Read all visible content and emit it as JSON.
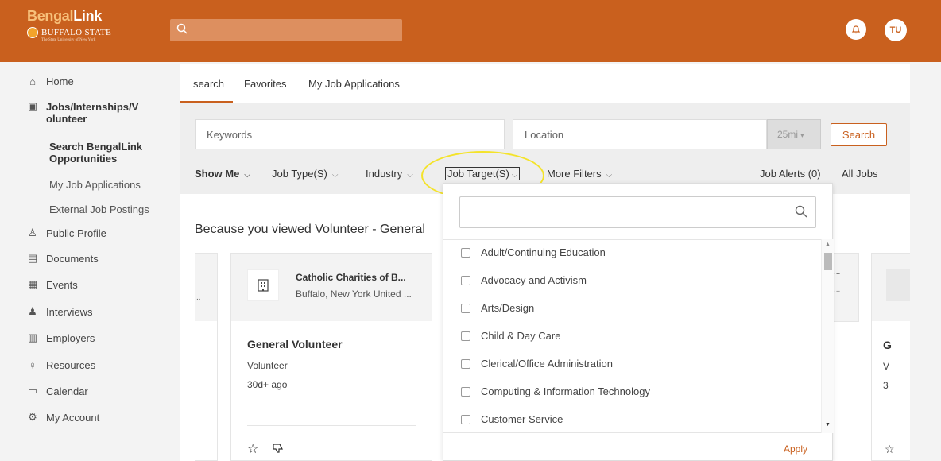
{
  "header": {
    "logo_top_a": "Bengal",
    "logo_top_b": "Link",
    "logo_school": "BUFFALO STATE",
    "logo_tag": "The State University of New York",
    "user_initials": "TU"
  },
  "sidebar": {
    "home": "Home",
    "jobs": "Jobs/Internships/V olunteer",
    "jobs_line1": "Jobs/Internships/V",
    "jobs_line2": "olunteer",
    "search_opps_1": "Search BengalLink",
    "search_opps_2": "Opportunities",
    "my_job_apps": "My Job Applications",
    "external": "External Job Postings",
    "public_profile": "Public Profile",
    "documents": "Documents",
    "events": "Events",
    "interviews": "Interviews",
    "employers": "Employers",
    "resources": "Resources",
    "calendar": "Calendar",
    "my_account": "My Account"
  },
  "tabs": {
    "search": "search",
    "favorites": "Favorites",
    "applications": "My Job Applications"
  },
  "filters": {
    "keywords_placeholder": "Keywords",
    "location_placeholder": "Location",
    "radius": "25mi",
    "search_btn": "Search",
    "show_me": "Show Me",
    "job_type": "Job Type(S)",
    "industry": "Industry",
    "job_target": "Job Target(S)",
    "more_filters": "More Filters",
    "job_alerts": "Job Alerts (0)",
    "all_jobs": "All Jobs"
  },
  "section": {
    "because": "Because you viewed Volunteer - General"
  },
  "job_card": {
    "employer": "Catholic Charities of B...",
    "location": "Buffalo, New York United ...",
    "title": "General Volunteer",
    "type": "Volunteer",
    "posted": "30d+ ago"
  },
  "right_card": {
    "t": "G",
    "ty": "V",
    "p": "3"
  },
  "dropdown": {
    "options": [
      "Adult/Continuing Education",
      "Advocacy and Activism",
      "Arts/Design",
      "Child & Day Care",
      "Clerical/Office Administration",
      "Computing & Information Technology",
      "Customer Service"
    ],
    "apply": "Apply"
  }
}
